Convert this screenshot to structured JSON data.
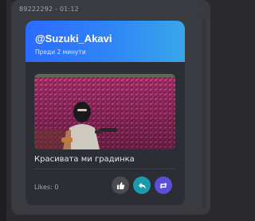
{
  "meta": {
    "phone_and_time": "89222292 - 01:12"
  },
  "tweet": {
    "username": "@Suzuki_Akavi",
    "posted_ago": "Преди 2 минути",
    "caption": "Красивата ми градинка",
    "likes_label": "Likes: 0",
    "image": {
      "subject": "masked person with gun in front of pink flowering hedge",
      "colors": {
        "hedge": "#9b2a62",
        "hedge_light": "#c9468a",
        "sky": "#6a7a5a"
      }
    }
  },
  "actions": [
    {
      "name": "like",
      "icon": "thumbs-up-icon",
      "color": "#4b4c52"
    },
    {
      "name": "reply",
      "icon": "reply-icon",
      "color": "#1a9bad"
    },
    {
      "name": "retweet",
      "icon": "retweet-icon",
      "color": "#5b4fd6"
    }
  ],
  "colors": {
    "header_gradient_start": "#2b6bff",
    "header_gradient_end": "#38a6ea",
    "card_background": "#2c2d35",
    "panel_background": "#3a3b40"
  }
}
